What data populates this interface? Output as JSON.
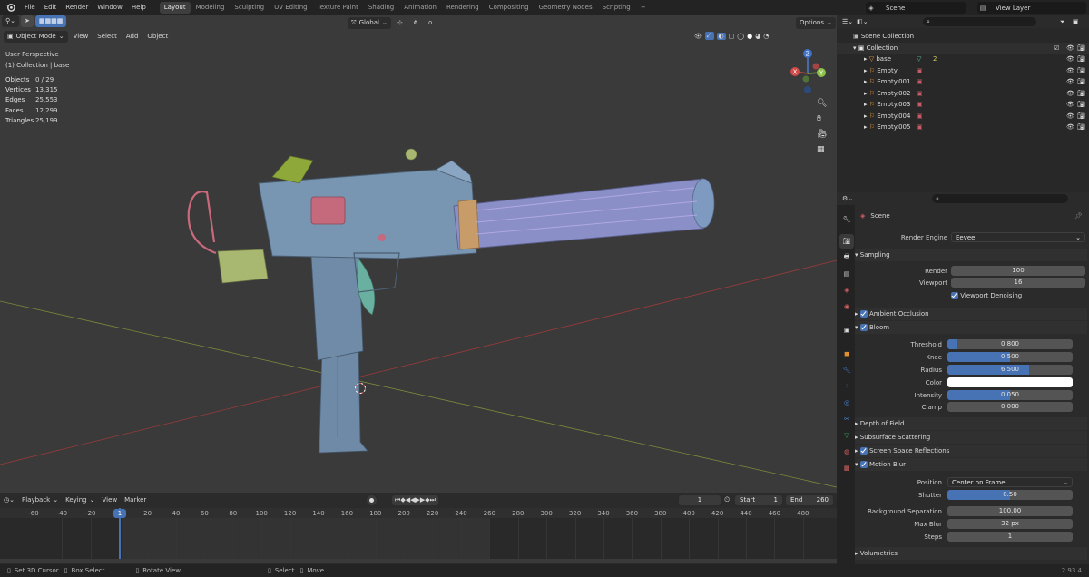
{
  "topbar": {
    "menus": [
      "File",
      "Edit",
      "Render",
      "Window",
      "Help"
    ],
    "workspaces": [
      "Layout",
      "Modeling",
      "Sculpting",
      "UV Editing",
      "Texture Paint",
      "Shading",
      "Animation",
      "Rendering",
      "Compositing",
      "Geometry Nodes",
      "Scripting"
    ],
    "active_workspace": "Layout",
    "add_tab": "+",
    "scene_name": "Scene",
    "view_layer": "View Layer"
  },
  "viewport_header": {
    "mode": "Object Mode",
    "menus": [
      "View",
      "Select",
      "Add",
      "Object"
    ],
    "orientation": "Global",
    "options": "Options"
  },
  "viewport_overlay": {
    "perspective": "User Perspective",
    "collection": "(1) Collection | base",
    "stats": [
      {
        "label": "Objects",
        "value": "0 / 29"
      },
      {
        "label": "Vertices",
        "value": "13,315"
      },
      {
        "label": "Edges",
        "value": "25,553"
      },
      {
        "label": "Faces",
        "value": "12,299"
      },
      {
        "label": "Triangles",
        "value": "25,199"
      }
    ]
  },
  "gizmo": {
    "z": "Z",
    "y": "Y",
    "x": "X"
  },
  "outliner": {
    "root": "Scene Collection",
    "collection": "Collection",
    "items": [
      {
        "name": "base",
        "type": "mesh"
      },
      {
        "name": "Empty",
        "type": "empty"
      },
      {
        "name": "Empty.001",
        "type": "empty"
      },
      {
        "name": "Empty.002",
        "type": "empty"
      },
      {
        "name": "Empty.003",
        "type": "empty"
      },
      {
        "name": "Empty.004",
        "type": "empty"
      },
      {
        "name": "Empty.005",
        "type": "empty"
      }
    ],
    "base_badge": "2"
  },
  "properties": {
    "scene_label": "Scene",
    "render_engine_label": "Render Engine",
    "render_engine_value": "Eevee",
    "sampling": {
      "title": "Sampling",
      "render_label": "Render",
      "render_value": "100",
      "viewport_label": "Viewport",
      "viewport_value": "16",
      "denoise_label": "Viewport Denoising"
    },
    "ambient_occlusion": "Ambient Occlusion",
    "bloom": {
      "title": "Bloom",
      "threshold_label": "Threshold",
      "threshold_value": "0.800",
      "threshold_fill": 0.07,
      "knee_label": "Knee",
      "knee_value": "0.500",
      "knee_fill": 0.5,
      "radius_label": "Radius",
      "radius_value": "6.500",
      "radius_fill": 0.65,
      "color_label": "Color",
      "color_value": "#ffffff",
      "intensity_label": "Intensity",
      "intensity_value": "0.050",
      "intensity_fill": 0.5,
      "clamp_label": "Clamp",
      "clamp_value": "0.000",
      "clamp_fill": 0
    },
    "depth_of_field": "Depth of Field",
    "subsurface": "Subsurface Scattering",
    "ssr": "Screen Space Reflections",
    "motion_blur": {
      "title": "Motion Blur",
      "position_label": "Position",
      "position_value": "Center on Frame",
      "shutter_label": "Shutter",
      "shutter_value": "0.50",
      "shutter_fill": 0.5,
      "bg_sep_label": "Background Separation",
      "bg_sep_value": "100.00",
      "max_blur_label": "Max Blur",
      "max_blur_value": "32 px",
      "steps_label": "Steps",
      "steps_value": "1"
    },
    "volumetrics": "Volumetrics"
  },
  "timeline": {
    "menus": [
      "Playback",
      "Keying",
      "View",
      "Marker"
    ],
    "current_frame": "1",
    "start_label": "Start",
    "start_value": "1",
    "end_label": "End",
    "end_value": "260",
    "ruler": [
      "-60",
      "-40",
      "-20",
      "1",
      "20",
      "40",
      "60",
      "80",
      "100",
      "120",
      "140",
      "160",
      "180",
      "200",
      "220",
      "240",
      "260",
      "280",
      "300",
      "320",
      "340",
      "360",
      "380",
      "400",
      "420",
      "440",
      "460",
      "480"
    ]
  },
  "statusbar": {
    "items": [
      "Set 3D Cursor",
      "Box Select",
      "Rotate View",
      "Select",
      "Move"
    ],
    "version": "2.93.4"
  },
  "colors": {
    "accent": "#4772b3",
    "timeline_cursor": "#4772b3"
  }
}
